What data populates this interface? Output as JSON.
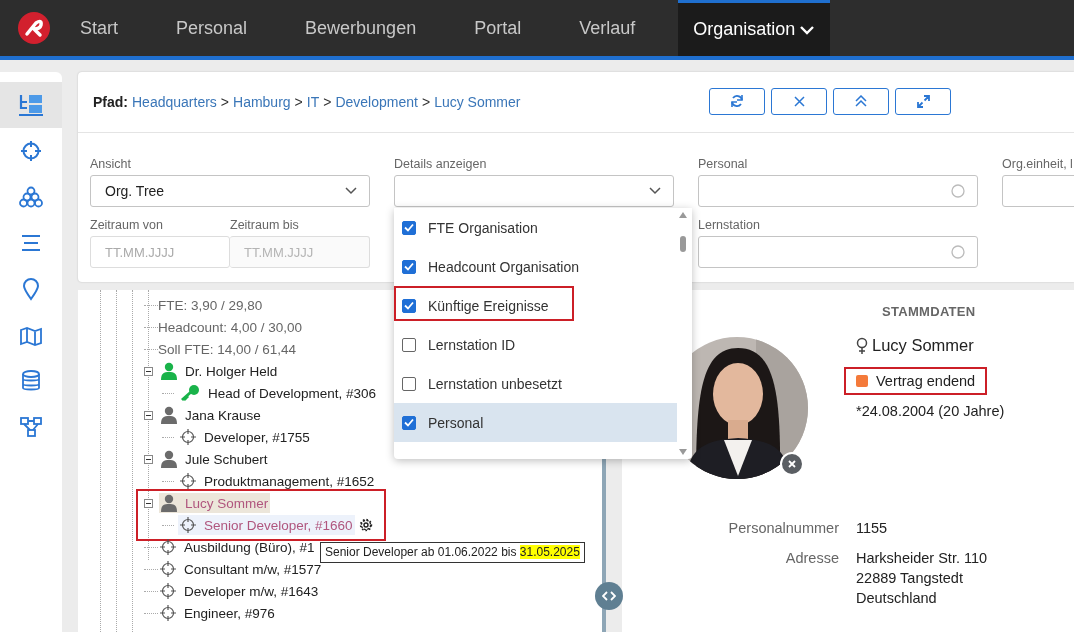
{
  "nav": {
    "tabs": [
      {
        "label": "Start",
        "selected": false,
        "menu": false
      },
      {
        "label": "Personal",
        "selected": false,
        "menu": false
      },
      {
        "label": "Bewerbungen",
        "selected": false,
        "menu": false
      },
      {
        "label": "Portal",
        "selected": false,
        "menu": false
      },
      {
        "label": "Verlauf",
        "selected": false,
        "menu": false
      },
      {
        "label": "Organisation",
        "selected": true,
        "menu": true
      }
    ]
  },
  "sidebar": {
    "items": [
      {
        "kind": "tree",
        "selected": true
      },
      {
        "kind": "crosshair",
        "selected": false
      },
      {
        "kind": "cluster",
        "selected": false
      },
      {
        "kind": "lines",
        "selected": false
      },
      {
        "kind": "pin",
        "selected": false
      },
      {
        "kind": "map",
        "selected": false
      },
      {
        "kind": "database",
        "selected": false
      },
      {
        "kind": "network",
        "selected": false
      }
    ]
  },
  "path": {
    "label": "Pfad:",
    "separator": ">",
    "crumbs": [
      "Headquarters",
      "Hamburg",
      "IT",
      "Development",
      "Lucy Sommer"
    ]
  },
  "toolbar": [
    {
      "kind": "refresh"
    },
    {
      "kind": "close"
    },
    {
      "kind": "collapse"
    },
    {
      "kind": "expand"
    }
  ],
  "filters": {
    "view": {
      "label": "Ansicht",
      "value": "Org. Tree"
    },
    "details": {
      "label": "Details anzeigen",
      "options": [
        {
          "label": "FTE Organisation",
          "checked": true,
          "selected": false,
          "highlighted": false
        },
        {
          "label": "Headcount Organisation",
          "checked": true,
          "selected": false,
          "highlighted": false
        },
        {
          "label": "Künftige Ereignisse",
          "checked": true,
          "selected": false,
          "highlighted": true
        },
        {
          "label": "Lernstation ID",
          "checked": false,
          "selected": false,
          "highlighted": false
        },
        {
          "label": "Lernstation unbesetzt",
          "checked": false,
          "selected": false,
          "highlighted": false
        },
        {
          "label": "Personal",
          "checked": true,
          "selected": true,
          "highlighted": false
        }
      ]
    },
    "personal": {
      "label": "Personal"
    },
    "org_unit": {
      "label": "Org.einheit, l"
    },
    "period_from": {
      "label": "Zeitraum von",
      "placeholder": "TT.MM.JJJJ",
      "disabled": false
    },
    "period_to": {
      "label": "Zeitraum bis",
      "placeholder": "TT.MM.JJJJ",
      "disabled": true
    },
    "learning_station": {
      "label": "Lernstation"
    }
  },
  "tree": {
    "stats": [
      "FTE: 3,90 / 29,80",
      "Headcount: 4,00 / 30,00",
      "Soll FTE: 14,00 / 61,44"
    ],
    "people": [
      {
        "name": "Dr. Holger Held",
        "kind": "lead",
        "expanded": true,
        "selected": false,
        "highlighted": false,
        "children": [
          {
            "label": "Head of Development, #306",
            "kind": "key",
            "selected": false,
            "settings": false
          }
        ]
      },
      {
        "name": "Jana Krause",
        "kind": "employee",
        "expanded": true,
        "selected": false,
        "highlighted": false,
        "children": [
          {
            "label": "Developer, #1755",
            "kind": "position",
            "selected": false,
            "settings": false
          }
        ]
      },
      {
        "name": "Jule Schubert",
        "kind": "employee",
        "expanded": true,
        "selected": false,
        "highlighted": false,
        "children": [
          {
            "label": "Produktmanagement, #1652",
            "kind": "position",
            "selected": false,
            "settings": false
          }
        ]
      },
      {
        "name": "Lucy Sommer",
        "kind": "employee",
        "expanded": true,
        "selected": true,
        "highlighted": true,
        "children": [
          {
            "label": "Senior Developer, #1660",
            "kind": "position",
            "selected": true,
            "settings": true
          }
        ]
      }
    ],
    "positions": [
      "Ausbildung (Büro), #1",
      "Consultant m/w, #1577",
      "Developer m/w, #1643",
      "Engineer, #976"
    ],
    "tooltip": {
      "text": "Senior Developer ab 01.06.2022 bis",
      "highlight": "31.05.2025"
    }
  },
  "profile": {
    "heading": "STAMMDATEN",
    "name": "Lucy Sommer",
    "status": {
      "label": "Vertrag endend",
      "color": "#f47a3a",
      "highlighted": true
    },
    "birth": "*24.08.2004 (20 Jahre)",
    "fields": [
      {
        "label": "Personalnummer",
        "lines": [
          "1155"
        ]
      },
      {
        "label": "Adresse",
        "lines": [
          "Harksheider Str. 110",
          "22889 Tangstedt",
          "Deutschland"
        ]
      }
    ]
  }
}
